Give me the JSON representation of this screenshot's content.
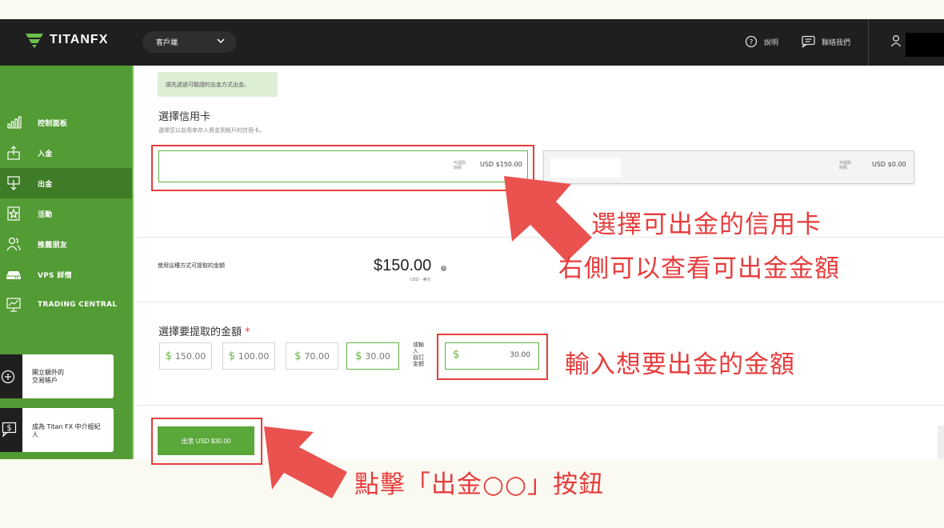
{
  "header": {
    "logo_text": "TITANFX",
    "client_select": "客戶端",
    "help_label": "說明",
    "contact_label": "聯絡我們"
  },
  "sidebar": {
    "items": [
      {
        "label": "控制面板",
        "icon": "bar-chart-icon"
      },
      {
        "label": "入金",
        "icon": "deposit-icon"
      },
      {
        "label": "出金",
        "icon": "withdraw-icon",
        "active": true
      },
      {
        "label": "活動",
        "icon": "promotion-icon"
      },
      {
        "label": "推薦朋友",
        "icon": "refer-friend-icon"
      },
      {
        "label": "VPS 詳情",
        "icon": "vps-icon"
      },
      {
        "label": "TRADING CENTRAL",
        "icon": "trading-central-icon"
      }
    ],
    "promos": [
      {
        "label": "開立額外的交易帳戶",
        "line1": "開立額外的",
        "line2": "交易帳戶",
        "icon": "plus-circle-icon"
      },
      {
        "label": "成為 Titan FX 中介經紀人",
        "line1": "成為 Titan FX 中介經紀",
        "line2": "人",
        "icon": "money-chat-icon"
      }
    ]
  },
  "main": {
    "notice": "請先透過可驗證的出金方式出金。",
    "card_section": {
      "title": "選擇信用卡",
      "subtitle": "選擇您以前用來存入資金到帳戶的信用卡。",
      "cards": [
        {
          "tiny_line1": "可提取",
          "tiny_line2": "餘額",
          "amount": "USD $150.00",
          "selected": true
        },
        {
          "tiny_line1": "可提取",
          "tiny_line2": "餘額",
          "amount": "USD $0.00",
          "selected": false
        }
      ]
    },
    "available": {
      "label": "使用這種方式可提取的金額",
      "amount": "$150.00",
      "unit": "USD - 美元",
      "info": "i"
    },
    "amount_section": {
      "title": "選擇要提取的金額",
      "required_mark": "*",
      "currency_symbol": "$",
      "presets": [
        "150.00",
        "100.00",
        "70.00",
        "30.00"
      ],
      "selected_preset": "30.00",
      "or_label": "或輸入自訂金額",
      "or_lines": [
        "或輸入",
        "自訂",
        "金額"
      ],
      "custom_value": "30.00"
    },
    "submit_label": "出金 USD $30.00"
  },
  "annotations": {
    "card_line1": "選擇可出金的信用卡",
    "card_line2": "右側可以查看可出金金額",
    "input_text": "輸入想要出金的金額",
    "button_text": "點擊「出金○○」按鈕",
    "color": "#e63c3c"
  },
  "colors": {
    "brand_green": "#539b34",
    "accent_green": "#64b040",
    "topbar": "#1f1f1f",
    "annotation_red": "#e63c3c"
  }
}
